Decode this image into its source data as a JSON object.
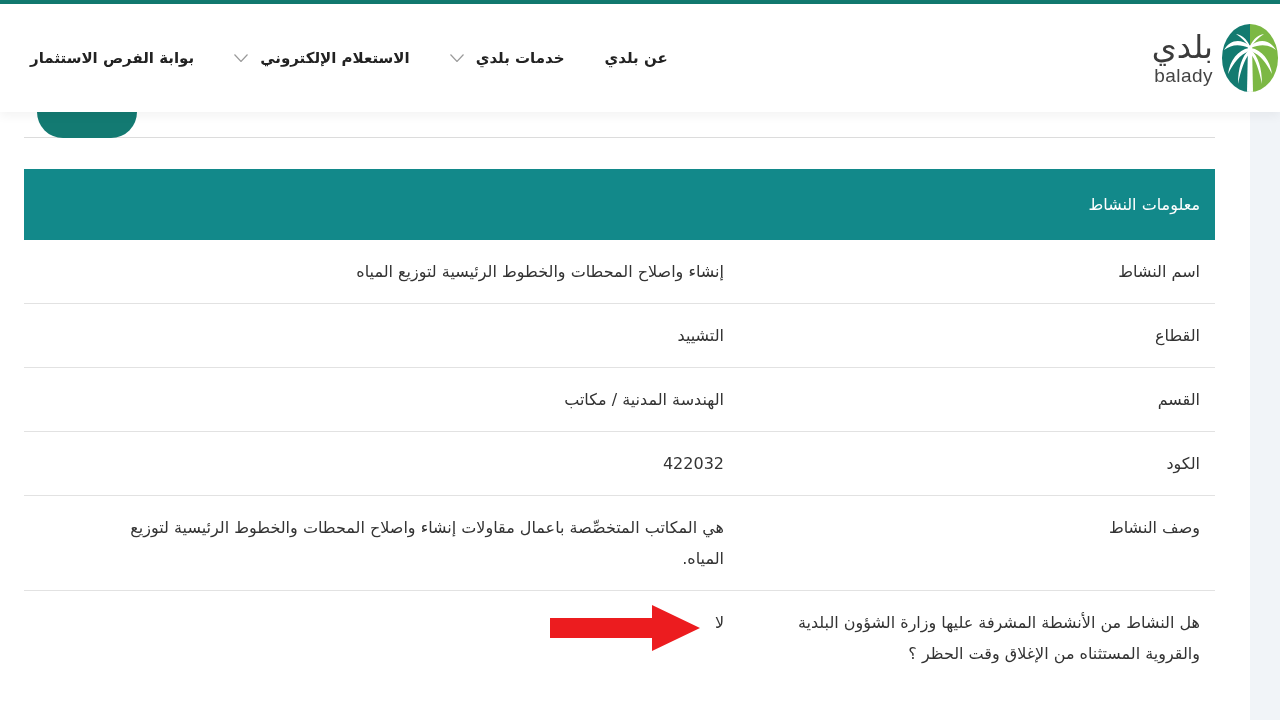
{
  "header": {
    "logo": {
      "arabic": "بلدي",
      "latin": "balady"
    },
    "nav": [
      {
        "label": "عن بلدي",
        "dropdown": false
      },
      {
        "label": "خدمات بلدي",
        "dropdown": true
      },
      {
        "label": "الاستعلام الإلكتروني",
        "dropdown": true
      },
      {
        "label": "بوابة الفرص الاستثمار",
        "dropdown": false
      }
    ]
  },
  "section": {
    "title": "معلومات النشاط",
    "rows": [
      {
        "label": "اسم النشاط",
        "value": "إنشاء واصلاح المحطات والخطوط الرئيسية لتوزيع المياه",
        "pointed_at": false
      },
      {
        "label": "القطاع",
        "value": "التشييد",
        "pointed_at": false
      },
      {
        "label": "القسم",
        "value": "الهندسة المدنية / مكاتب",
        "pointed_at": false
      },
      {
        "label": "الكود",
        "value": "422032",
        "pointed_at": false
      },
      {
        "label": "وصف النشاط",
        "value": "هي المكاتب المتخصِّصة باعمال مقاولات إنشاء واصلاح المحطات والخطوط الرئيسية لتوزيع المياه.",
        "pointed_at": false
      },
      {
        "label": "هل النشاط من الأنشطة المشرفة عليها وزارة الشؤون البلدية والقروية المستثناه من الإغلاق وقت الحظر ؟",
        "value": "لا",
        "pointed_at": true
      }
    ]
  }
}
